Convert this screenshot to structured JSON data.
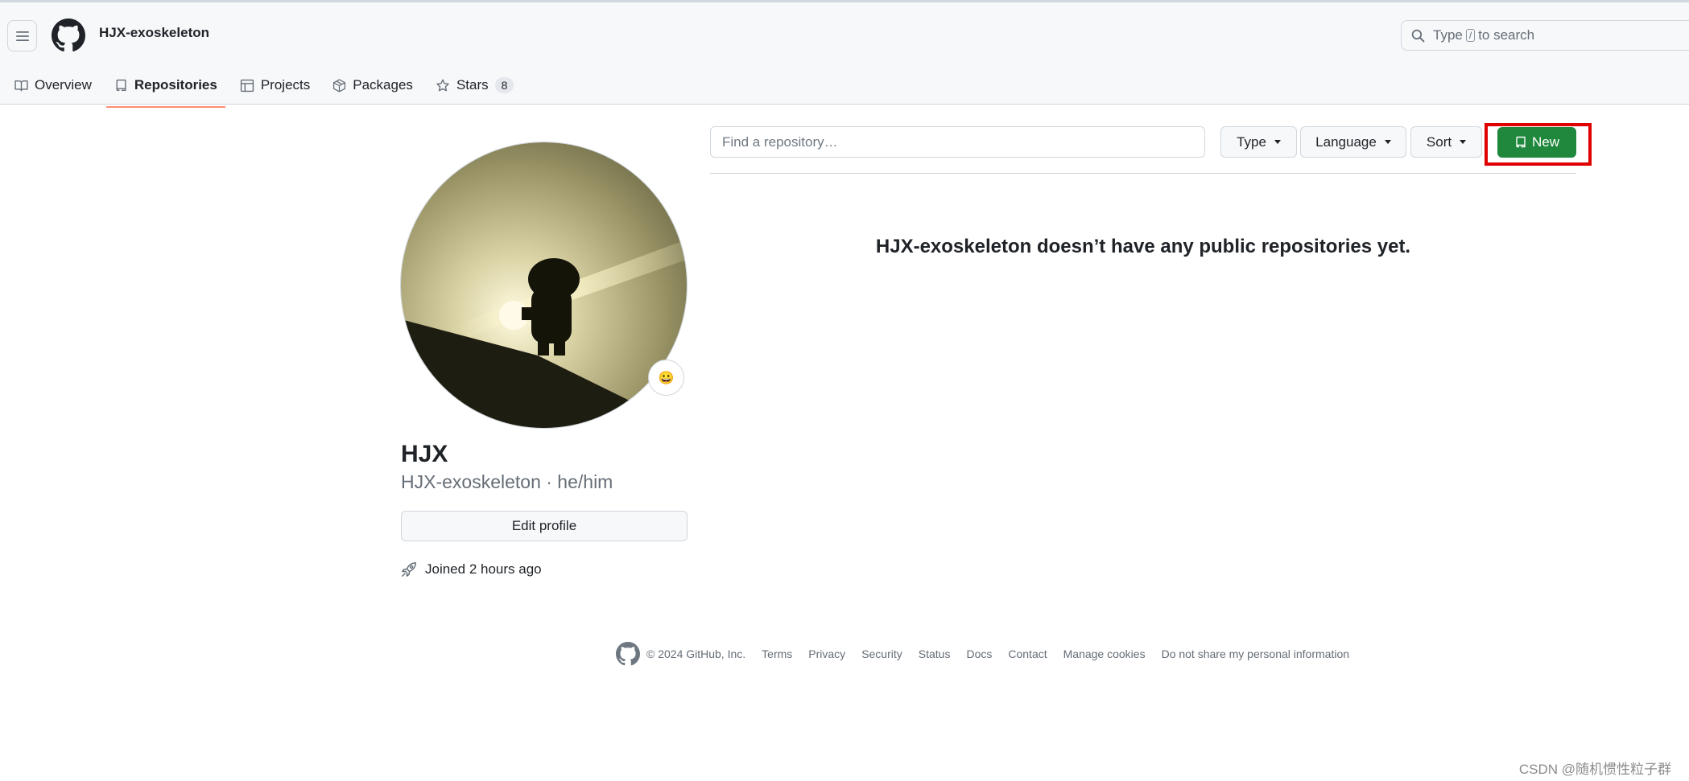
{
  "header": {
    "username": "HJX-exoskeleton",
    "search": {
      "before": "Type",
      "key": "/",
      "after": "to search"
    }
  },
  "tabs": [
    {
      "label": "Overview",
      "icon": "book-icon"
    },
    {
      "label": "Repositories",
      "icon": "repo-icon",
      "active": true
    },
    {
      "label": "Projects",
      "icon": "table-icon"
    },
    {
      "label": "Packages",
      "icon": "package-icon"
    },
    {
      "label": "Stars",
      "icon": "star-icon",
      "count": "8"
    }
  ],
  "profile": {
    "name": "HJX",
    "login_line": "HJX-exoskeleton · he/him",
    "edit_label": "Edit profile",
    "joined": "Joined 2 hours ago",
    "status_emoji": "😀"
  },
  "repos": {
    "search_placeholder": "Find a repository…",
    "filters": {
      "type": "Type",
      "language": "Language",
      "sort": "Sort"
    },
    "new_label": "New",
    "empty_message": "HJX-exoskeleton doesn’t have any public repositories yet."
  },
  "footer": {
    "copyright": "© 2024 GitHub, Inc.",
    "links": [
      "Terms",
      "Privacy",
      "Security",
      "Status",
      "Docs",
      "Contact",
      "Manage cookies",
      "Do not share my personal information"
    ]
  },
  "watermark": "CSDN @随机惯性粒子群",
  "colors": {
    "accent_green": "#1f883d",
    "tab_underline": "#fd8c73",
    "highlight_red": "#e00000"
  }
}
